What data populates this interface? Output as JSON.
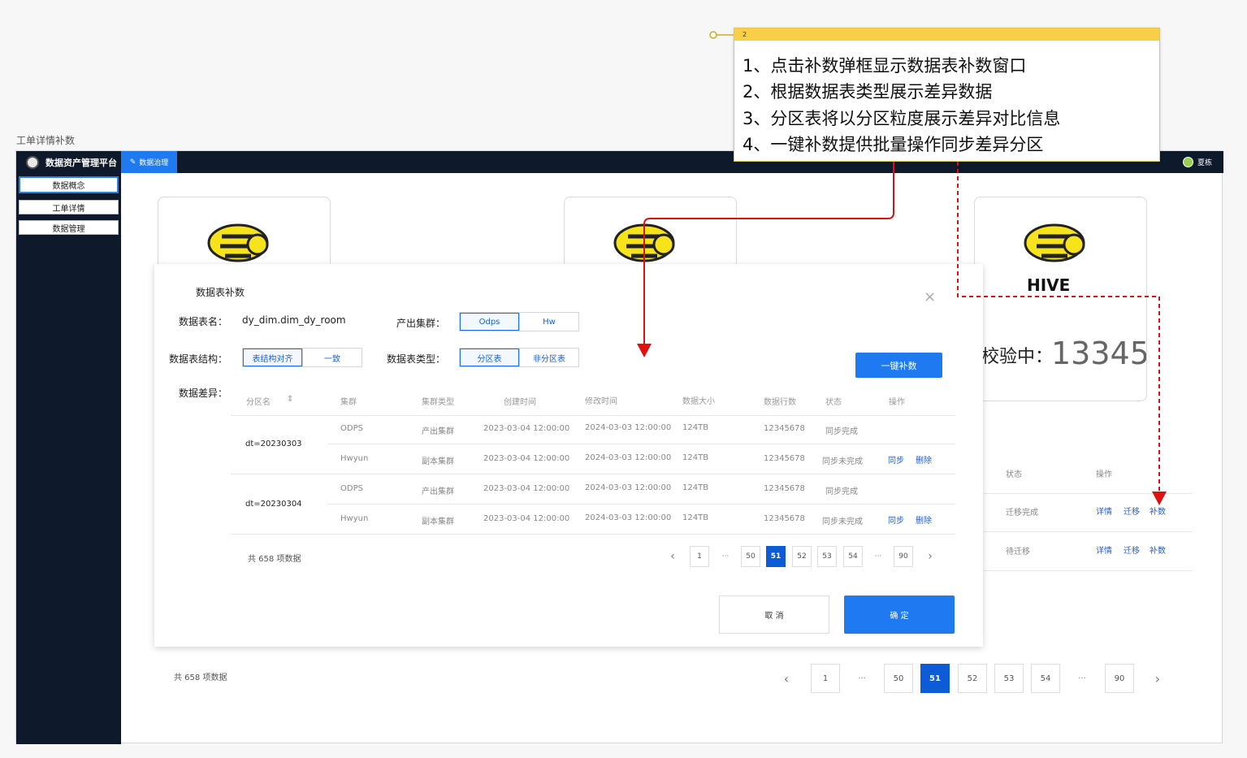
{
  "page_caption": "工单详情补数",
  "app": {
    "brand": "数据资产管理平台",
    "nav_tab": "数据治理",
    "user_name": "夏栋"
  },
  "sidebar": {
    "items": [
      {
        "label": "数据概念"
      },
      {
        "label": "工单详情"
      },
      {
        "label": "数据管理"
      }
    ]
  },
  "card": {
    "label": "校验中：",
    "value": "13345",
    "logo_text": "HIVE"
  },
  "background_table": {
    "headers": {
      "status": "状态",
      "action": "操作"
    },
    "rows": [
      {
        "status": "迁移完成",
        "actions": [
          "详情",
          "迁移",
          "补数"
        ]
      },
      {
        "status": "待迁移",
        "actions": [
          "详情",
          "迁移",
          "补数"
        ]
      }
    ],
    "total": "共 658 项数据",
    "pages": [
      "1",
      "···",
      "50",
      "51",
      "52",
      "53",
      "54",
      "···",
      "90"
    ],
    "current_page": "51"
  },
  "modal": {
    "title": "数据表补数",
    "table_name_label": "数据表名：",
    "table_name_value": "dy_dim.dim_dy_room",
    "cluster_label": "产出集群：",
    "cluster_options": [
      "Odps",
      "Hw"
    ],
    "structure_label": "数据表结构：",
    "structure_options": [
      "表结构对齐",
      "一致"
    ],
    "type_label": "数据表类型：",
    "type_options": [
      "分区表",
      "非分区表"
    ],
    "one_click_button": "一键补数",
    "diff_label": "数据差异：",
    "columns": [
      "分区名",
      "集群",
      "集群类型",
      "创建时间",
      "修改时间",
      "数据大小",
      "数据行数",
      "状态",
      "操作"
    ],
    "groups": [
      {
        "partition": "dt=20230303",
        "rows": [
          {
            "cluster": "ODPS",
            "type": "产出集群",
            "created": "2023-03-04 12:00:00",
            "modified": "2024-03-03 12:00:00",
            "size": "124TB",
            "rows": "12345678",
            "status": "同步完成",
            "actions": []
          },
          {
            "cluster": "Hwyun",
            "type": "副本集群",
            "created": "2023-03-04 12:00:00",
            "modified": "2024-03-03 12:00:00",
            "size": "124TB",
            "rows": "12345678",
            "status": "同步未完成",
            "actions": [
              "同步",
              "删除"
            ]
          }
        ]
      },
      {
        "partition": "dt=20230304",
        "rows": [
          {
            "cluster": "ODPS",
            "type": "产出集群",
            "created": "2023-03-04 12:00:00",
            "modified": "2024-03-03 12:00:00",
            "size": "124TB",
            "rows": "12345678",
            "status": "同步完成",
            "actions": []
          },
          {
            "cluster": "Hwyun",
            "type": "副本集群",
            "created": "2023-03-04 12:00:00",
            "modified": "2024-03-03 12:00:00",
            "size": "124TB",
            "rows": "12345678",
            "status": "同步未完成",
            "actions": [
              "同步",
              "删除"
            ]
          }
        ]
      }
    ],
    "total": "共 658 项数据",
    "pages": [
      "1",
      "···",
      "50",
      "51",
      "52",
      "53",
      "54",
      "···",
      "90"
    ],
    "current_page": "51",
    "cancel_button": "取 消",
    "ok_button": "确 定"
  },
  "annotation": {
    "number": "2",
    "lines": [
      "1、点击补数弹框显示数据表补数窗口",
      "2、根据数据表类型展示差异数据",
      "3、分区表将以分区粒度展示差异对比信息",
      "4、一键补数提供批量操作同步差异分区"
    ],
    "arrow_color": "#e01010",
    "note_color": "#f9cf47"
  },
  "colors": {
    "nav_bg": "#0e1a2b",
    "primary": "#1f7af2",
    "current_page": "#0e5bd7",
    "link": "#1f5fd6"
  }
}
